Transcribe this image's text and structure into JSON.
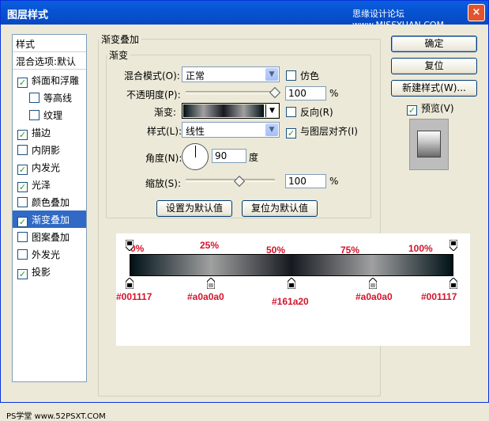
{
  "window": {
    "title": "图层样式",
    "watermark_top": "思缘设计论坛  www.MISSYUAN.COM",
    "close": "×"
  },
  "sidebar": {
    "header": "样式",
    "blend_options": "混合选项:默认",
    "items": [
      {
        "label": "斜面和浮雕",
        "checked": "✓"
      },
      {
        "label": "等高线",
        "checked": ""
      },
      {
        "label": "纹理",
        "checked": ""
      },
      {
        "label": "描边",
        "checked": "✓"
      },
      {
        "label": "内阴影",
        "checked": ""
      },
      {
        "label": "内发光",
        "checked": "✓"
      },
      {
        "label": "光泽",
        "checked": "✓"
      },
      {
        "label": "颜色叠加",
        "checked": ""
      },
      {
        "label": "渐变叠加",
        "checked": "✓"
      },
      {
        "label": "图案叠加",
        "checked": ""
      },
      {
        "label": "外发光",
        "checked": ""
      },
      {
        "label": "投影",
        "checked": "✓"
      }
    ]
  },
  "main": {
    "outer_legend": "渐变叠加",
    "inner_legend": "渐变",
    "blend_mode_label": "混合模式(O):",
    "blend_mode_value": "正常",
    "dither_label": "仿色",
    "opacity_label": "不透明度(P):",
    "opacity_value": "100",
    "opacity_pct": 1.0,
    "gradient_label": "渐变:",
    "reverse_label": "反向(R)",
    "style_label": "样式(L):",
    "style_value": "线性",
    "align_label": "与图层对齐(I)",
    "angle_label": "角度(N):",
    "angle_value": "90",
    "degree_unit": "度",
    "scale_label": "缩放(S):",
    "scale_value": "100",
    "percent_unit": "%",
    "set_default": "设置为默认值",
    "reset_default": "复位为默认值"
  },
  "buttons": {
    "ok": "确定",
    "reset": "复位",
    "new_style": "新建样式(W)...",
    "preview": "预览(V)",
    "preview_checked": "✓"
  },
  "gradient_annotations": {
    "percents": [
      "0%",
      "25%",
      "50%",
      "75%",
      "100%"
    ],
    "colors": [
      "#001117",
      "#a0a0a0",
      "#161a20",
      "#a0a0a0",
      "#001117"
    ]
  },
  "watermark_bottom": "PS学堂  www.52PSXT.COM",
  "colors": {
    "accent_select": "#316ac5",
    "annotation": "#d3142b",
    "title_bar": "#0654d4"
  }
}
